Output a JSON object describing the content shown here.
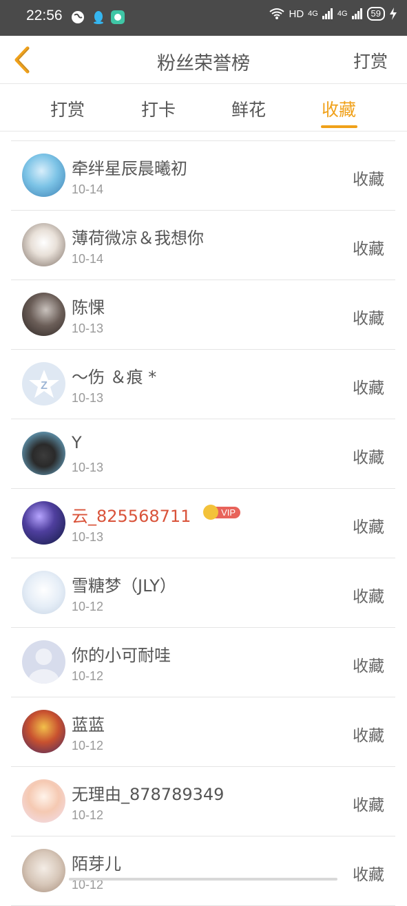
{
  "status_bar": {
    "time": "22:56",
    "network": "HD",
    "signal1": "4G",
    "signal2": "4G",
    "battery": "59"
  },
  "header": {
    "title": "粉丝荣誉榜",
    "right_action": "打赏"
  },
  "tabs": [
    {
      "label": "打赏",
      "active": false
    },
    {
      "label": "打卡",
      "active": false
    },
    {
      "label": "鲜花",
      "active": false
    },
    {
      "label": "收藏",
      "active": true
    }
  ],
  "colors": {
    "accent": "#f0a11a",
    "vip_name": "#d9533a",
    "status_bar_bg": "#4a4a4a"
  },
  "vip_badge_label": "VIP",
  "rows": [
    {
      "name": "牵绊星辰晨曦初",
      "date": "10-14",
      "action": "收藏",
      "vip": false
    },
    {
      "name": "薄荷微凉＆我想你",
      "date": "10-14",
      "action": "收藏",
      "vip": false
    },
    {
      "name": "陈惈",
      "date": "10-13",
      "action": "收藏",
      "vip": false
    },
    {
      "name": "～伤 ＆痕 *",
      "date": "10-13",
      "action": "收藏",
      "vip": false
    },
    {
      "name": "Y",
      "date": "10-13",
      "action": "收藏",
      "vip": false
    },
    {
      "name": "云_825568711",
      "date": "10-13",
      "action": "收藏",
      "vip": true
    },
    {
      "name": "雪糖梦（JLY）",
      "date": "10-12",
      "action": "收藏",
      "vip": false
    },
    {
      "name": "你的小可耐哇",
      "date": "10-12",
      "action": "收藏",
      "vip": false
    },
    {
      "name": "蓝蓝",
      "date": "10-12",
      "action": "收藏",
      "vip": false
    },
    {
      "name": "无理由_878789349",
      "date": "10-12",
      "action": "收藏",
      "vip": false
    },
    {
      "name": "陌芽儿",
      "date": "10-12",
      "action": "收藏",
      "vip": false
    }
  ]
}
